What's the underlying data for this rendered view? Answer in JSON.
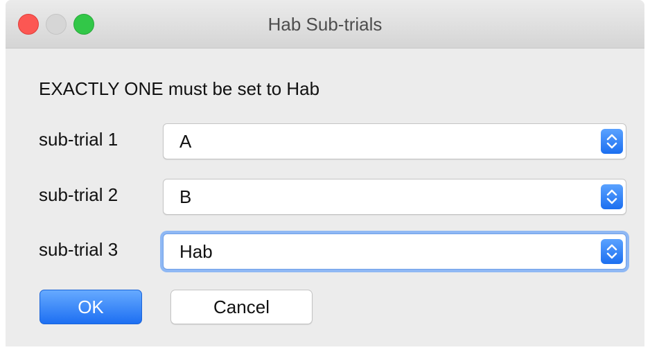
{
  "window": {
    "title": "Hab Sub-trials"
  },
  "dialog": {
    "message": "EXACTLY ONE must be set to Hab",
    "rows": [
      {
        "label": "sub-trial 1",
        "value": "A"
      },
      {
        "label": "sub-trial 2",
        "value": "B"
      },
      {
        "label": "sub-trial 3",
        "value": "Hab"
      }
    ],
    "focused_row": "sub-trial 3"
  },
  "buttons": {
    "ok": "OK",
    "cancel": "Cancel"
  },
  "colors": {
    "accent": "#1d6ff2",
    "focus_ring": "#8fb8f4",
    "window_bg": "#ececec"
  },
  "icons": [
    "close-light",
    "minimize-light",
    "maximize-light",
    "chevron-up-down-icon"
  ]
}
